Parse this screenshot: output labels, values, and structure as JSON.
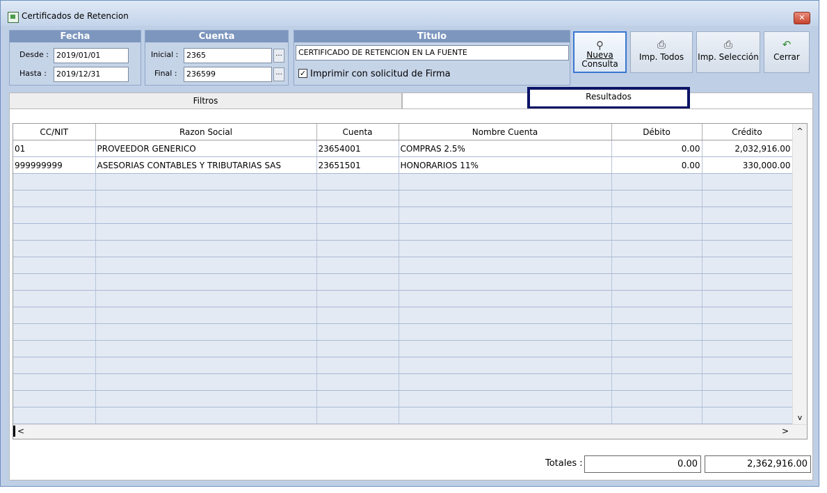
{
  "window": {
    "title": "Certificados de Retencion",
    "close_label": "✕"
  },
  "fecha": {
    "header": "Fecha",
    "desde_label": "Desde :",
    "desde_value": "2019/01/01",
    "hasta_label": "Hasta :",
    "hasta_value": "2019/12/31"
  },
  "cuenta": {
    "header": "Cuenta",
    "inicial_label": "Inicial :",
    "inicial_value": "2365",
    "final_label": "Final :",
    "final_value": "236599",
    "browse_label": "..."
  },
  "titulo": {
    "header": "Titulo",
    "value": "CERTIFICADO DE RETENCION EN LA FUENTE",
    "firma_label": "Imprimir con solicitud de Firma",
    "firma_checked": true,
    "check_glyph": "✓"
  },
  "toolbar": {
    "nueva_line1": "Nueva",
    "nueva_line2": "Consulta",
    "imp_todos": "Imp. Todos",
    "imp_seleccion": "Imp. Selección",
    "cerrar": "Cerrar"
  },
  "tabs": {
    "filtros": "Filtros",
    "resultados": "Resultados"
  },
  "grid": {
    "headers": [
      "CC/NIT",
      "Razon Social",
      "Cuenta",
      "Nombre Cuenta",
      "Débito",
      "Crédito"
    ],
    "rows": [
      [
        "01",
        "PROVEEDOR GENERICO",
        "23654001",
        "COMPRAS 2.5%",
        "0.00",
        "2,032,916.00"
      ],
      [
        "999999999",
        "ASESORIAS CONTABLES Y TRIBUTARIAS SAS",
        "23651501",
        "HONORARIOS 11%",
        "0.00",
        "330,000.00"
      ]
    ],
    "scroll_up": "^",
    "scroll_down": "v",
    "scroll_left": "<",
    "scroll_right": ">"
  },
  "totals": {
    "label": "Totales :",
    "debito": "0.00",
    "credito": "2,362,916.00"
  }
}
